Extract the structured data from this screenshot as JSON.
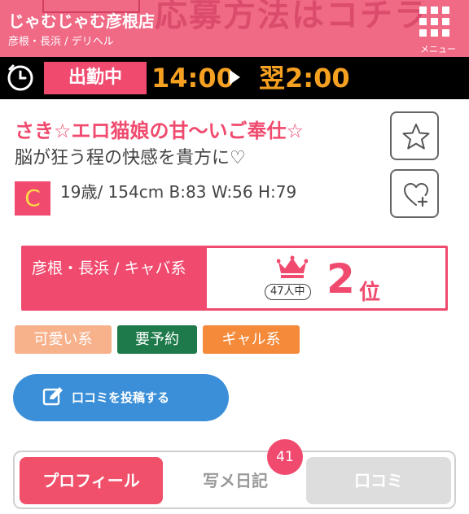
{
  "header": {
    "banner_text": "応募方法はコチラ",
    "shop_name": "じゃむじゃむ彦根店",
    "shop_area": "彦根・長浜 / デリヘル",
    "menu_label": "メニュー"
  },
  "shift": {
    "status": "出勤中",
    "start": "14:00",
    "end": "翌2:00"
  },
  "profile": {
    "catchphrase": "さき☆エロ猫娘の甘〜いご奉仕☆",
    "sub_catch": "脳が狂う程の快感を貴方に♡",
    "cup": "C",
    "stats": "19歳/ 154cm B:83 W:56 H:79"
  },
  "ranking": {
    "category": "彦根・長浜 / キャバ系",
    "count_label": "47人中",
    "rank": "2",
    "rank_unit": "位"
  },
  "tags": [
    {
      "label": "可愛い系",
      "color": "#f7b28c"
    },
    {
      "label": "要予約",
      "color": "#1e7a4a"
    },
    {
      "label": "ギャル系",
      "color": "#f48a3a"
    }
  ],
  "review_button": {
    "label": "口コミを投稿する"
  },
  "tabs": {
    "profile": "プロフィール",
    "diary": "写メ日記",
    "diary_badge": "41",
    "review": "口コミ"
  },
  "colors": {
    "header": "#f06a86",
    "accent": "#f04a6e",
    "time": "#f5a020",
    "button_blue": "#3a8fd8"
  },
  "icons": [
    "menu-grid-icon",
    "clock-icon",
    "star-icon",
    "heart-plus-icon",
    "crown-icon",
    "edit-icon"
  ]
}
